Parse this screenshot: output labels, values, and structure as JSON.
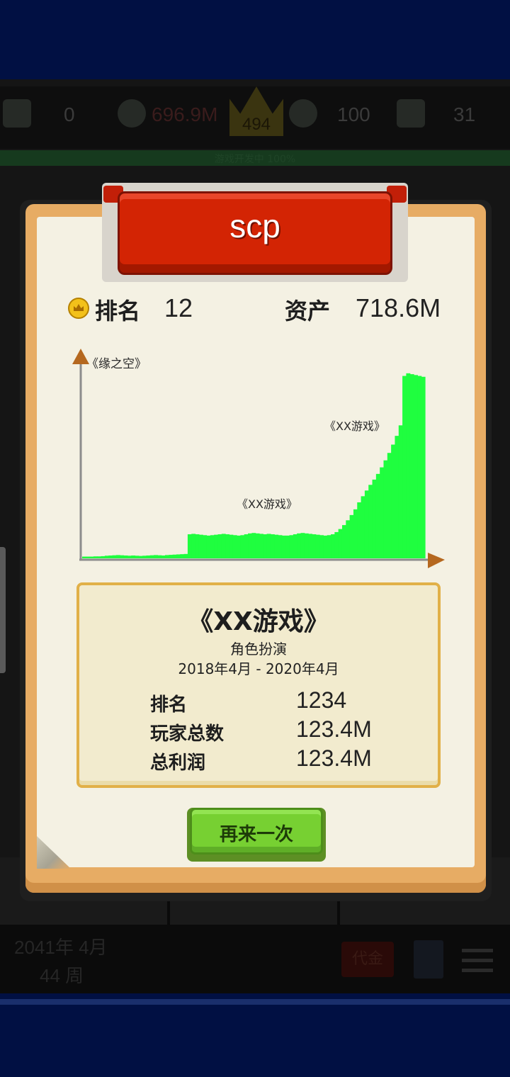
{
  "stats": {
    "players": "0",
    "money": "696.9M",
    "crown_rank": "494",
    "fans": "100",
    "hours": "31",
    "progress_text": "游戏开发中 100%"
  },
  "footer": {
    "date": "2041年 4月",
    "week": "44 周",
    "action_button": "代金"
  },
  "card": {
    "player_name": "scp",
    "rank_label": "排名",
    "rank_value": "12",
    "asset_label": "资产",
    "asset_value": "718.6M",
    "retry_label": "再来一次"
  },
  "summary": {
    "game_title": "《XX游戏》",
    "genre": "角色扮演",
    "period": "2018年4月 - 2020年4月",
    "rows": [
      {
        "label": "排名",
        "value": "1234"
      },
      {
        "label": "玩家总数",
        "value": "123.4M"
      },
      {
        "label": "总利润",
        "value": "123.4M"
      }
    ]
  },
  "chart_data": {
    "type": "area",
    "title": "",
    "xlabel": "",
    "ylabel": "",
    "color": "#1ffe3f",
    "annotations": [
      "《缘之空》",
      "《XX游戏》",
      "《XX游戏》"
    ],
    "values": [
      0.8,
      0.8,
      0.8,
      0.9,
      0.9,
      1.0,
      1.2,
      1.3,
      1.4,
      1.5,
      1.4,
      1.3,
      1.2,
      1.3,
      1.2,
      1.1,
      1.2,
      1.3,
      1.4,
      1.5,
      1.4,
      1.3,
      1.5,
      1.6,
      1.7,
      1.8,
      1.9,
      2.0,
      11.0,
      11.2,
      11.0,
      10.8,
      10.6,
      10.4,
      10.6,
      10.8,
      11.0,
      11.2,
      11.0,
      10.8,
      10.6,
      10.4,
      10.6,
      11.0,
      11.4,
      11.6,
      11.4,
      11.2,
      11.0,
      11.2,
      11.0,
      10.8,
      10.6,
      10.4,
      10.4,
      10.6,
      11.0,
      11.4,
      11.6,
      11.4,
      11.2,
      11.0,
      10.8,
      10.6,
      10.4,
      10.6,
      11.0,
      12.0,
      13.4,
      15.2,
      17.4,
      19.8,
      22.4,
      25.6,
      28.4,
      31.0,
      33.6,
      36.0,
      38.6,
      41.6,
      44.8,
      48.2,
      52.0,
      56.0,
      60.8,
      83.4,
      84.6,
      84.2,
      83.8,
      83.4,
      83.0
    ],
    "ylim": [
      0,
      92
    ]
  }
}
